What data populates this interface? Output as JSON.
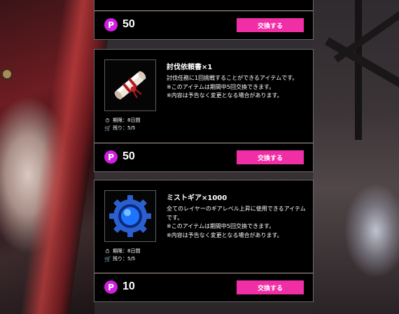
{
  "cards": [
    {
      "points": "50",
      "button": "交換する"
    },
    {
      "icon": "scroll-item-icon",
      "title": "討伐依頼書×1",
      "desc": "討伐任務に1回挑戦することができるアイテムです。\n※このアイテムは期間中5回交換できます。\n※内容は予告なく変更となる場合があります。",
      "period": "期限：8日間",
      "stock": "残り：5/5",
      "points": "50",
      "button": "交換する"
    },
    {
      "icon": "mist-gear-icon",
      "title": "ミストギア×1000",
      "desc": "全てのレイヤーのギアレベル上昇に使用できるアイテムです。\n※このアイテムは期間中5回交換できます。\n※内容は予告なく変更となる場合があります。",
      "period": "期限：8日間",
      "stock": "残り：5/5",
      "points": "10",
      "button": "交換する"
    }
  ],
  "coin_label": "P",
  "colors": {
    "accent": "#f02fa6",
    "coin": "#d11ee0"
  }
}
